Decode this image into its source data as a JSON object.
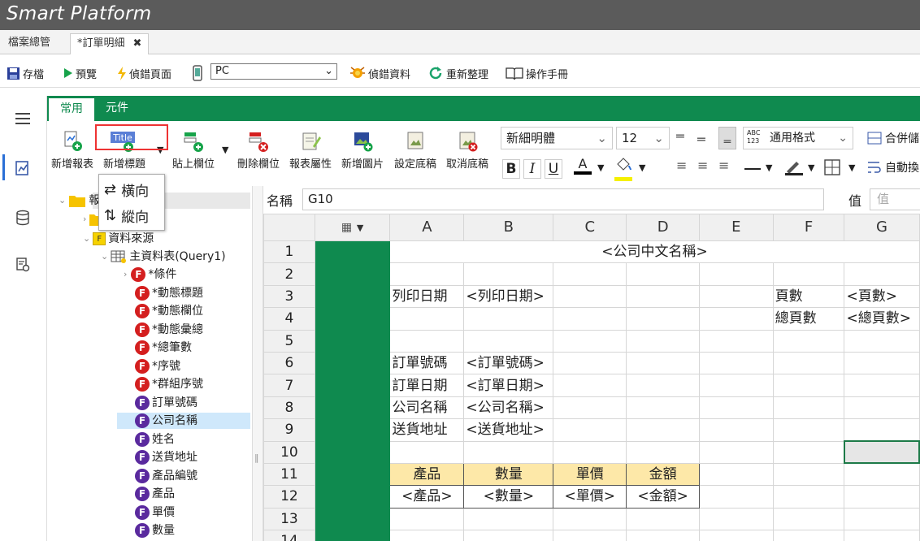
{
  "app": {
    "title": "Smart Platform"
  },
  "tabs": [
    {
      "label": "檔案總管"
    },
    {
      "label": "*訂單明細",
      "close": "✖"
    }
  ],
  "toolbar": {
    "save": "存檔",
    "preview": "預覽",
    "debug_page": "偵錯頁面",
    "device_value": "PC",
    "debug_data": "偵錯資料",
    "refresh": "重新整理",
    "manual": "操作手冊"
  },
  "ribbon": {
    "tabs": [
      "常用",
      "元件"
    ],
    "buttons": {
      "new_report": "新增報表",
      "new_title": "新增標題",
      "title_icon_text": "Title",
      "paste_field": "貼上欄位",
      "delete_field": "刪除欄位",
      "report_props": "報表屬性",
      "add_image": "新增圖片",
      "set_background": "設定底稿",
      "cancel_background": "取消底稿"
    },
    "font_family": "新細明體",
    "font_size": "12",
    "number_format": "通用格式",
    "number_format_icon": "ABC 123",
    "merge": "合併儲",
    "autofit": "自動換",
    "bold": "B",
    "italic": "I",
    "underline": "U"
  },
  "dropdown": {
    "horizontal": "橫向",
    "vertical": "縱向"
  },
  "tree": {
    "root": "報",
    "datasource": "資料來源",
    "main_table": "主資料表(Query1)",
    "items": [
      {
        "label": "*條件",
        "color": "red"
      },
      {
        "label": "*動態標題",
        "color": "red"
      },
      {
        "label": "*動態欄位",
        "color": "red"
      },
      {
        "label": "*動態彙總",
        "color": "red"
      },
      {
        "label": "*總筆數",
        "color": "red"
      },
      {
        "label": "*序號",
        "color": "red"
      },
      {
        "label": "*群組序號",
        "color": "red"
      },
      {
        "label": "訂單號碼",
        "color": "purple"
      },
      {
        "label": "公司名稱",
        "color": "purple",
        "selected": true
      },
      {
        "label": "姓名",
        "color": "purple"
      },
      {
        "label": "送貨地址",
        "color": "purple"
      },
      {
        "label": "產品編號",
        "color": "purple"
      },
      {
        "label": "產品",
        "color": "purple"
      },
      {
        "label": "單價",
        "color": "purple"
      },
      {
        "label": "數量",
        "color": "purple"
      }
    ]
  },
  "namebar": {
    "name_label": "名稱",
    "name_value": "G10",
    "value_label": "值",
    "value_placeholder": "值"
  },
  "sheet": {
    "columns": [
      "A",
      "B",
      "C",
      "D",
      "E",
      "F",
      "G"
    ],
    "rows": [
      "1",
      "2",
      "3",
      "4",
      "5",
      "6",
      "7",
      "8",
      "9",
      "10",
      "11",
      "12",
      "13",
      "14"
    ],
    "cells": {
      "r1": "<公司中文名稱>",
      "r3a": "列印日期",
      "r3b": "<列印日期>",
      "r3f": "頁數",
      "r3g": "<頁數>",
      "r4f": "總頁數",
      "r4g": "<總頁數>",
      "r6a": "訂單號碼",
      "r6b": "<訂單號碼>",
      "r7a": "訂單日期",
      "r7b": "<訂單日期>",
      "r8a": "公司名稱",
      "r8b": "<公司名稱>",
      "r9a": "送貨地址",
      "r9b": "<送貨地址>",
      "r11a": "產品",
      "r11b": "數量",
      "r11c": "單價",
      "r11d": "金額",
      "r12a": "<產品>",
      "r12b": "<數量>",
      "r12c": "<單價>",
      "r12d": "<金額>"
    }
  },
  "colors": {
    "accent": "#0f8a4f",
    "highlight": "#e33333",
    "header_fill": "#fde8a8",
    "selected_row": "#cfe8fb"
  }
}
